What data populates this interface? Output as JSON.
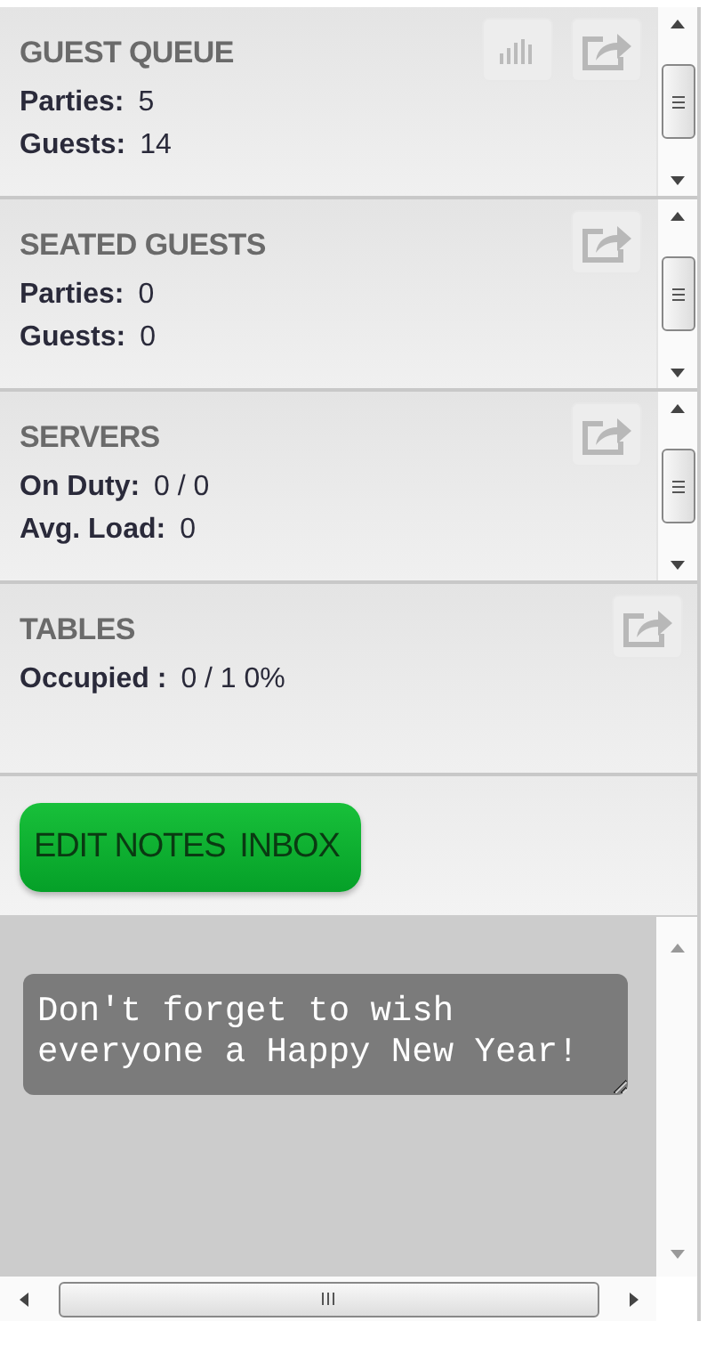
{
  "panels": [
    {
      "title": "GUEST QUEUE",
      "actions": [
        {
          "kind": "chart"
        },
        {
          "kind": "share"
        }
      ],
      "scrollbar": true,
      "stats": [
        {
          "label": "Parties:",
          "value": "5"
        },
        {
          "label": "Guests:",
          "value": "14"
        }
      ]
    },
    {
      "title": "SEATED GUESTS",
      "actions": [
        {
          "kind": "share"
        }
      ],
      "scrollbar": true,
      "stats": [
        {
          "label": "Parties:",
          "value": "0"
        },
        {
          "label": "Guests:",
          "value": "0"
        }
      ]
    },
    {
      "title": "SERVERS",
      "actions": [
        {
          "kind": "share"
        }
      ],
      "scrollbar": true,
      "stats": [
        {
          "label": "On Duty:",
          "value": "0 / 0"
        },
        {
          "label": "Avg. Load:",
          "value": "0"
        }
      ]
    },
    {
      "title": "TABLES",
      "actions": [
        {
          "kind": "share"
        }
      ],
      "scrollbar": false,
      "stats": [
        {
          "label": "Occupied :",
          "value": "0 / 1 0%"
        }
      ]
    }
  ],
  "buttons": [
    {
      "label": "EDIT NOTES"
    },
    {
      "label": "INBOX"
    }
  ],
  "notes": {
    "value": "Don't forget to wish everyone a Happy New Year!"
  }
}
